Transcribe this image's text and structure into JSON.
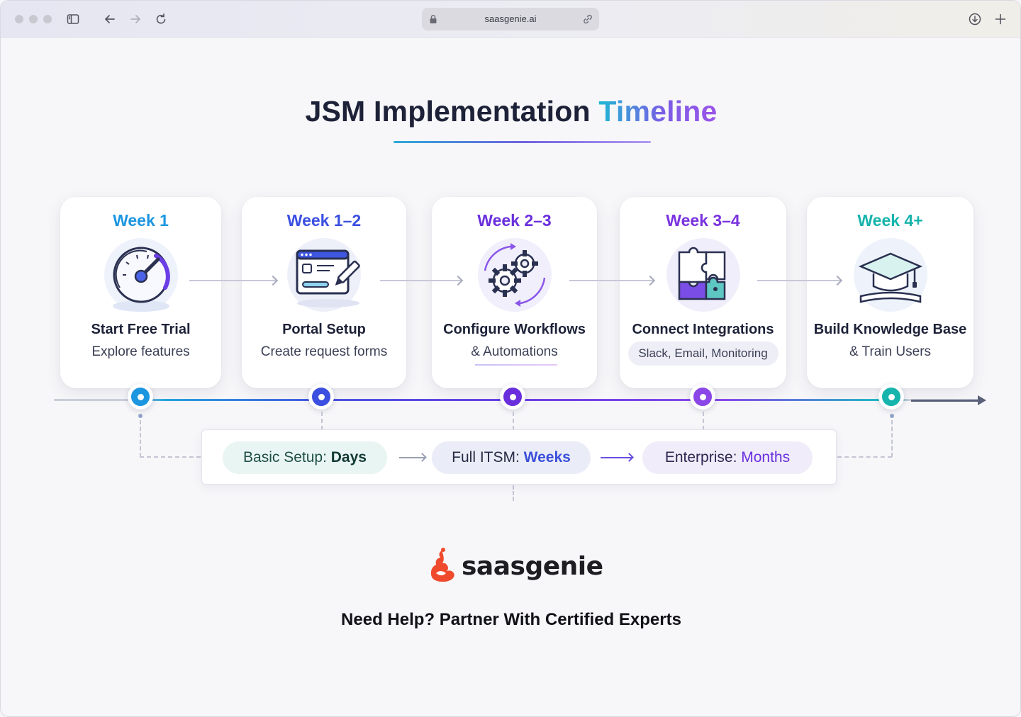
{
  "browser": {
    "url": "saasgenie.ai",
    "icons": [
      "sidebar-toggle-icon",
      "back-arrow-icon",
      "forward-arrow-icon",
      "reload-icon",
      "lock-icon",
      "link-icon",
      "download-icon",
      "plus-icon"
    ]
  },
  "page": {
    "title_main": "JSM Implementation",
    "title_accent": "Timeline"
  },
  "steps": [
    {
      "week": "Week 1",
      "heading": "Start Free Trial",
      "sub": "Explore features",
      "color": "#1d96e0",
      "icon": "speedometer-icon"
    },
    {
      "week": "Week 1–2",
      "heading": "Portal Setup",
      "sub": "Create request forms",
      "color": "#3b4fe0",
      "icon": "form-pencil-icon"
    },
    {
      "week": "Week 2–3",
      "heading": "Configure Workflows",
      "sub": "& Automations",
      "color": "#6a2fdc",
      "icon": "gears-icon"
    },
    {
      "week": "Week 3–4",
      "heading": "Connect Integrations",
      "sub": "Slack, Email, Monitoring",
      "color": "#7a33de",
      "icon": "puzzle-icon"
    },
    {
      "week": "Week 4+",
      "heading": "Build Knowledge Base",
      "sub": "& Train Users",
      "color": "#16b4ac",
      "icon": "graduation-cap-icon"
    }
  ],
  "scale": [
    {
      "label": "Basic Setup:",
      "value": "Days",
      "bg": "#e9f5f2",
      "label_color": "#1f4f46",
      "value_color": "#123a34"
    },
    {
      "label": "Full ITSM:",
      "value": "Weeks",
      "bg": "#eaedf7",
      "label_color": "#262b45",
      "value_color": "#3b4fd9"
    },
    {
      "label": "Enterprise:",
      "value": "Months",
      "bg": "#f0ecfa",
      "label_color": "#2f2750",
      "value_color": "#6a2fdc"
    }
  ],
  "brand": {
    "name": "saasgenie",
    "logo_color": "#f04a2e"
  },
  "cta": "Need Help? Partner With Certified Experts"
}
